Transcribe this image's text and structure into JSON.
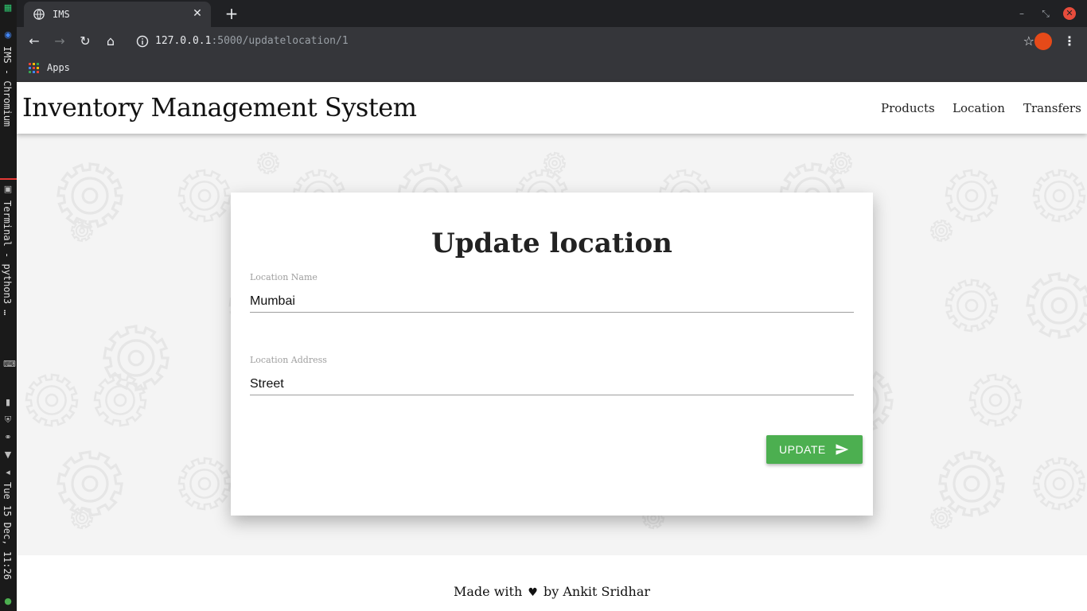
{
  "taskbar": {
    "window_label": "IMS - Chromium",
    "terminal_label": "Terminal - python3 …",
    "clock": "Tue 15 Dec, 11:26"
  },
  "browser": {
    "tab_title": "IMS",
    "new_tab_symbol": "+",
    "url_host": "127.0.0.1",
    "url_rest": ":5000/updatelocation/1",
    "bookmark_apps": "Apps",
    "apps_colors": [
      "#ea4335",
      "#fbbc05",
      "#34a853",
      "#4285f4",
      "#ea4335",
      "#fbbc05",
      "#34a853",
      "#4285f4",
      "#ea4335"
    ]
  },
  "site": {
    "brand": "Inventory Management System",
    "nav": {
      "products": "Products",
      "location": "Location",
      "transfers": "Transfers"
    }
  },
  "form": {
    "title": "Update location",
    "name_label": "Location Name",
    "name_value": "Mumbai",
    "address_label": "Location Address",
    "address_value": "Street",
    "submit_label": "UPDATE",
    "submit_color": "#4caf50"
  },
  "footer": {
    "prefix": "Made with",
    "heart": "♥",
    "suffix": "by Ankit Sridhar"
  }
}
